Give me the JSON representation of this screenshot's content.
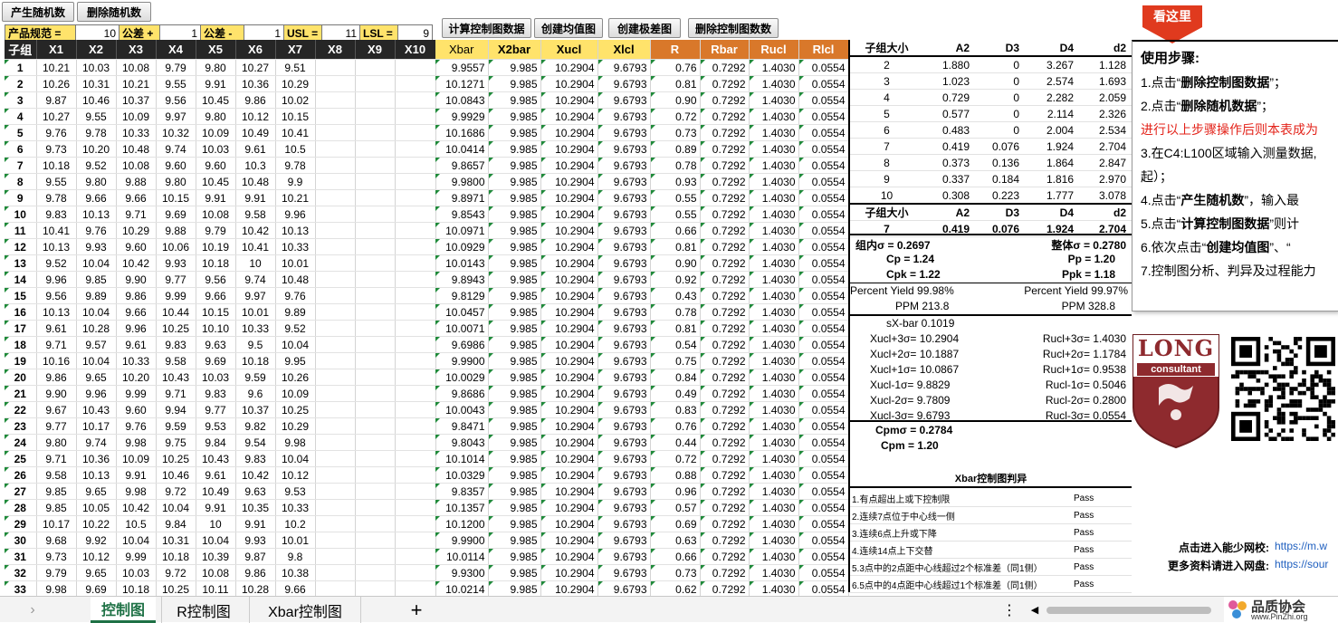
{
  "toolbar": {
    "gen_random": "产生随机数",
    "del_random": "删除随机数",
    "calc_chart": "计算控制图数据",
    "make_mean": "创建均值图",
    "make_range": "创建极差图",
    "del_chart": "删除控制图数数"
  },
  "spec": {
    "product_label": "产品规范 =",
    "product_value": "10",
    "tol_plus_label": "公差 +",
    "tol_plus_value": "1",
    "tol_minus_label": "公差 -",
    "tol_minus_value": "1",
    "usl_label": "USL =",
    "usl_value": "11",
    "lsl_label": "LSL =",
    "lsl_value": "9"
  },
  "data_headers": [
    "子组",
    "X1",
    "X2",
    "X3",
    "X4",
    "X5",
    "X6",
    "X7",
    "X8",
    "X9",
    "X10"
  ],
  "data_rows": [
    [
      "1",
      "10.21",
      "10.03",
      "10.08",
      "9.79",
      "9.80",
      "10.27",
      "9.51"
    ],
    [
      "2",
      "10.26",
      "10.31",
      "10.21",
      "9.55",
      "9.91",
      "10.36",
      "10.29"
    ],
    [
      "3",
      "9.87",
      "10.46",
      "10.37",
      "9.56",
      "10.45",
      "9.86",
      "10.02"
    ],
    [
      "4",
      "10.27",
      "9.55",
      "10.09",
      "9.97",
      "9.80",
      "10.12",
      "10.15"
    ],
    [
      "5",
      "9.76",
      "9.78",
      "10.33",
      "10.32",
      "10.09",
      "10.49",
      "10.41"
    ],
    [
      "6",
      "9.73",
      "10.20",
      "10.48",
      "9.74",
      "10.03",
      "9.61",
      "10.5"
    ],
    [
      "7",
      "10.18",
      "9.52",
      "10.08",
      "9.60",
      "9.60",
      "10.3",
      "9.78"
    ],
    [
      "8",
      "9.55",
      "9.80",
      "9.88",
      "9.80",
      "10.45",
      "10.48",
      "9.9"
    ],
    [
      "9",
      "9.78",
      "9.66",
      "9.66",
      "10.15",
      "9.91",
      "9.91",
      "10.21"
    ],
    [
      "10",
      "9.83",
      "10.13",
      "9.71",
      "9.69",
      "10.08",
      "9.58",
      "9.96"
    ],
    [
      "11",
      "10.41",
      "9.76",
      "10.29",
      "9.88",
      "9.79",
      "10.42",
      "10.13"
    ],
    [
      "12",
      "10.13",
      "9.93",
      "9.60",
      "10.06",
      "10.19",
      "10.41",
      "10.33"
    ],
    [
      "13",
      "9.52",
      "10.04",
      "10.42",
      "9.93",
      "10.18",
      "10",
      "10.01"
    ],
    [
      "14",
      "9.96",
      "9.85",
      "9.90",
      "9.77",
      "9.56",
      "9.74",
      "10.48"
    ],
    [
      "15",
      "9.56",
      "9.89",
      "9.86",
      "9.99",
      "9.66",
      "9.97",
      "9.76"
    ],
    [
      "16",
      "10.13",
      "10.04",
      "9.66",
      "10.44",
      "10.15",
      "10.01",
      "9.89"
    ],
    [
      "17",
      "9.61",
      "10.28",
      "9.96",
      "10.25",
      "10.10",
      "10.33",
      "9.52"
    ],
    [
      "18",
      "9.71",
      "9.57",
      "9.61",
      "9.83",
      "9.63",
      "9.5",
      "10.04"
    ],
    [
      "19",
      "10.16",
      "10.04",
      "10.33",
      "9.58",
      "9.69",
      "10.18",
      "9.95"
    ],
    [
      "20",
      "9.86",
      "9.65",
      "10.20",
      "10.43",
      "10.03",
      "9.59",
      "10.26"
    ],
    [
      "21",
      "9.90",
      "9.96",
      "9.99",
      "9.71",
      "9.83",
      "9.6",
      "10.09"
    ],
    [
      "22",
      "9.67",
      "10.43",
      "9.60",
      "9.94",
      "9.77",
      "10.37",
      "10.25"
    ],
    [
      "23",
      "9.77",
      "10.17",
      "9.76",
      "9.59",
      "9.53",
      "9.82",
      "10.29"
    ],
    [
      "24",
      "9.80",
      "9.74",
      "9.98",
      "9.75",
      "9.84",
      "9.54",
      "9.98"
    ],
    [
      "25",
      "9.71",
      "10.36",
      "10.09",
      "10.25",
      "10.43",
      "9.83",
      "10.04"
    ],
    [
      "26",
      "9.58",
      "10.13",
      "9.91",
      "10.46",
      "9.61",
      "10.42",
      "10.12"
    ],
    [
      "27",
      "9.85",
      "9.65",
      "9.98",
      "9.72",
      "10.49",
      "9.63",
      "9.53"
    ],
    [
      "28",
      "9.85",
      "10.05",
      "10.42",
      "10.04",
      "9.91",
      "10.35",
      "10.33"
    ],
    [
      "29",
      "10.17",
      "10.22",
      "10.5",
      "9.84",
      "10",
      "9.91",
      "10.2"
    ],
    [
      "30",
      "9.68",
      "9.92",
      "10.04",
      "10.31",
      "10.04",
      "9.93",
      "10.01"
    ],
    [
      "31",
      "9.73",
      "10.12",
      "9.99",
      "10.18",
      "10.39",
      "9.87",
      "9.8"
    ],
    [
      "32",
      "9.79",
      "9.65",
      "10.03",
      "9.72",
      "10.08",
      "9.86",
      "10.38"
    ],
    [
      "33",
      "9.98",
      "9.69",
      "10.18",
      "10.25",
      "10.11",
      "10.28",
      "9.66"
    ]
  ],
  "calc_headers": [
    "Xbar",
    "X2bar",
    "Xucl",
    "Xlcl",
    "R",
    "Rbar",
    "Rucl",
    "Rlcl"
  ],
  "calc_rows": [
    [
      "9.9557",
      "0.76"
    ],
    [
      "10.1271",
      "0.81"
    ],
    [
      "10.0843",
      "0.90"
    ],
    [
      "9.9929",
      "0.72"
    ],
    [
      "10.1686",
      "0.73"
    ],
    [
      "10.0414",
      "0.89"
    ],
    [
      "9.8657",
      "0.78"
    ],
    [
      "9.9800",
      "0.93"
    ],
    [
      "9.8971",
      "0.55"
    ],
    [
      "9.8543",
      "0.55"
    ],
    [
      "10.0971",
      "0.66"
    ],
    [
      "10.0929",
      "0.81"
    ],
    [
      "10.0143",
      "0.90"
    ],
    [
      "9.8943",
      "0.92"
    ],
    [
      "9.8129",
      "0.43"
    ],
    [
      "10.0457",
      "0.78"
    ],
    [
      "10.0071",
      "0.81"
    ],
    [
      "9.6986",
      "0.54"
    ],
    [
      "9.9900",
      "0.75"
    ],
    [
      "10.0029",
      "0.84"
    ],
    [
      "9.8686",
      "0.49"
    ],
    [
      "10.0043",
      "0.83"
    ],
    [
      "9.8471",
      "0.76"
    ],
    [
      "9.8043",
      "0.44"
    ],
    [
      "10.1014",
      "0.72"
    ],
    [
      "10.0329",
      "0.88"
    ],
    [
      "9.8357",
      "0.96"
    ],
    [
      "10.1357",
      "0.57"
    ],
    [
      "10.1200",
      "0.69"
    ],
    [
      "9.9900",
      "0.63"
    ],
    [
      "10.0114",
      "0.66"
    ],
    [
      "9.9300",
      "0.73"
    ],
    [
      "10.0214",
      "0.62"
    ]
  ],
  "calc_const": {
    "x2bar": "9.985",
    "xucl": "10.2904",
    "xlcl": "9.6793",
    "rbar": "0.7292",
    "rucl": "1.4030",
    "rlcl": "0.0554"
  },
  "factor_headers": [
    "子组大小",
    "A2",
    "D3",
    "D4",
    "d2"
  ],
  "factor_rows": [
    [
      "2",
      "1.880",
      "0",
      "3.267",
      "1.128"
    ],
    [
      "3",
      "1.023",
      "0",
      "2.574",
      "1.693"
    ],
    [
      "4",
      "0.729",
      "0",
      "2.282",
      "2.059"
    ],
    [
      "5",
      "0.577",
      "0",
      "2.114",
      "2.326"
    ],
    [
      "6",
      "0.483",
      "0",
      "2.004",
      "2.534"
    ],
    [
      "7",
      "0.419",
      "0.076",
      "1.924",
      "2.704"
    ],
    [
      "8",
      "0.373",
      "0.136",
      "1.864",
      "2.847"
    ],
    [
      "9",
      "0.337",
      "0.184",
      "1.816",
      "2.970"
    ],
    [
      "10",
      "0.308",
      "0.223",
      "1.777",
      "3.078"
    ]
  ],
  "factor_selected": [
    "7",
    "0.419",
    "0.076",
    "1.924",
    "2.704"
  ],
  "stats": {
    "sigma_within": "组内σ = 0.2697",
    "sigma_overall": "整体σ = 0.2780",
    "cp": "Cp = 1.24",
    "pp": "Pp = 1.20",
    "cpk": "Cpk = 1.22",
    "ppk": "Ppk = 1.18",
    "py1": "Percent Yield 99.98%",
    "py2": "Percent Yield 99.97%",
    "ppm1": "PPM 213.8",
    "ppm2": "PPM 328.8",
    "sxbar": "sX-bar 0.1019",
    "x_lines": [
      "Xucl+3σ= 10.2904",
      "Xucl+2σ= 10.1887",
      "Xucl+1σ= 10.0867",
      "Xucl-1σ= 9.8829",
      "Xucl-2σ= 9.7809",
      "Xucl-3σ= 9.6793"
    ],
    "r_lines": [
      "Rucl+3σ= 1.4030",
      "Rucl+2σ= 1.1784",
      "Rucl+1σ= 0.9538",
      "Rucl-1σ= 0.5046",
      "Rucl-2σ= 0.2800",
      "Rucl-3σ= 0.0554"
    ],
    "cpm_sigma": "Cpmσ = 0.2784",
    "cpm": "Cpm = 1.20"
  },
  "judge": {
    "title": "Xbar控制图判异",
    "rules": [
      [
        "1.有点超出上或下控制限",
        "Pass"
      ],
      [
        "2.连续7点位于中心线一侧",
        "Pass"
      ],
      [
        "3.连续6点上升或下降",
        "Pass"
      ],
      [
        "4.连续14点上下交替",
        "Pass"
      ],
      [
        "5.3点中的2点距中心线超过2个标准差（同1侧）",
        "Pass"
      ],
      [
        "6.5点中的4点距中心线超过1个标准差（同1侧）",
        "Pass"
      ]
    ]
  },
  "callout": {
    "label": "看这里"
  },
  "instructions": {
    "title": "使用步骤:",
    "s1a": "1.点击“",
    "s1b": "删除控制图数据",
    "s1c": "”；",
    "s2a": "2.点击“",
    "s2b": "删除随机数据",
    "s2c": "”；",
    "red": "进行以上步骤操作后则本表成为",
    "s3": "3.在C4:L100区域输入测量数据,",
    "s3b": "起）；",
    "s4a": "4.点击“",
    "s4b": "产生随机数",
    "s4c": "”，输入最",
    "s5a": "5.点击“",
    "s5b": "计算控制图数据",
    "s5c": "”则计",
    "s6a": "6.依次点击“",
    "s6b": "创建均值图",
    "s6c": "”、“",
    "s7": "7.控制图分析、判异及过程能力"
  },
  "logo": {
    "line1": "LONG",
    "line2": "consultant"
  },
  "links": {
    "l1": "点击进入能少网校:",
    "u1": "https://m.w",
    "l2": "更多资料请进入网盘:",
    "u2": "https://sour"
  },
  "tabs": [
    "控制图",
    "R控制图",
    "Xbar控制图"
  ],
  "brand": {
    "name": "品质协会",
    "url": "www.PinZhi.org"
  },
  "colors": {
    "header_dark": "#262626",
    "xbar_yellow": "#ffe36b",
    "r_orange": "#d9782a",
    "spec_yellow": "#ffe36b",
    "callout_red": "#e03a1e"
  }
}
